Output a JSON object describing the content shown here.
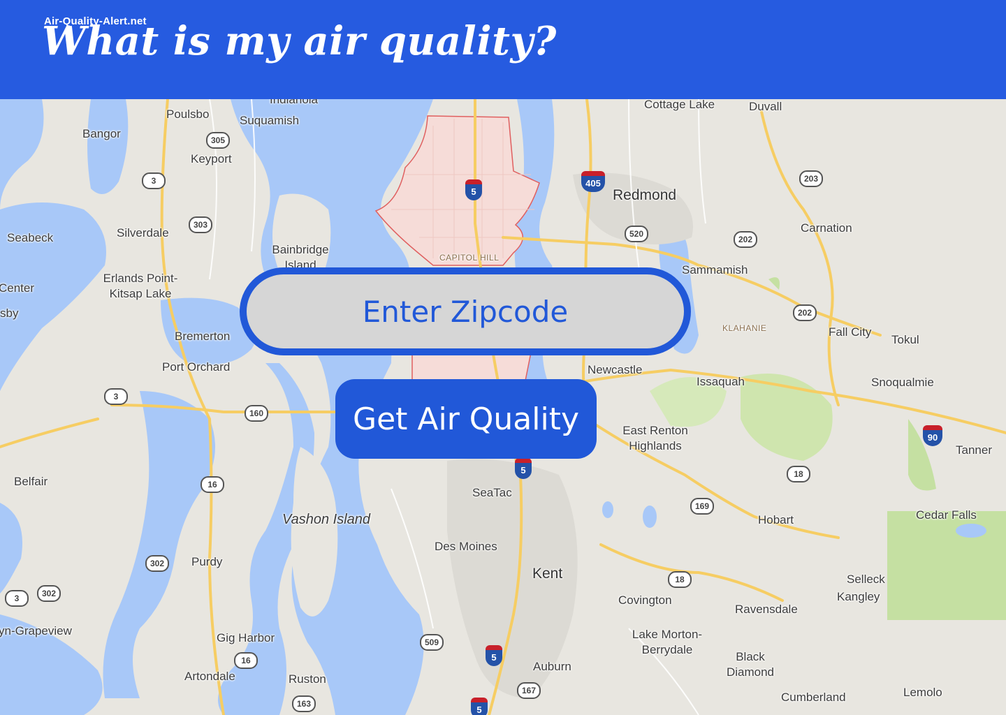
{
  "header": {
    "site_name": "Air-Quality-Alert.net",
    "title": "What is my air quality?"
  },
  "form": {
    "zip_placeholder": "Enter Zipcode",
    "submit_label": "Get Air Quality"
  },
  "map": {
    "places": {
      "indianola": "Indianola",
      "poulsbo": "Poulsbo",
      "suquamish": "Suquamish",
      "bangor": "Bangor",
      "keyport": "Keyport",
      "silverdale": "Silverdale",
      "seabeck": "Seabeck",
      "bainbridge": "Bainbridge Island",
      "erlands": "Erlands Point-Kitsap Lake",
      "center": "Center",
      "sby": "sby",
      "bremerton": "Bremerton",
      "port_orchard": "Port Orchard",
      "capitol_hill": "CAPITOL HILL",
      "cottage_lake": "Cottage Lake",
      "duvall": "Duvall",
      "redmond": "Redmond",
      "carnation": "Carnation",
      "sammamish": "Sammamish",
      "klahanie": "KLAHANIE",
      "fall_city": "Fall City",
      "tokul": "Tokul",
      "newcastle": "Newcastle",
      "issaquah": "Issaquah",
      "snoqualmie": "Snoqualmie",
      "east_renton": "East Renton Highlands",
      "tanner": "Tanner",
      "belfair": "Belfair",
      "seatac": "SeaTac",
      "vashon": "Vashon Island",
      "des_moines": "Des Moines",
      "hobart": "Hobart",
      "cedar_falls": "Cedar Falls",
      "purdy": "Purdy",
      "kent": "Kent",
      "selleck": "Selleck",
      "kangley": "Kangley",
      "covington": "Covington",
      "grapeview": "yn-Grapeview",
      "ravensdale": "Ravensdale",
      "gig_harbor": "Gig Harbor",
      "lake_morton": "Lake Morton-Berrydale",
      "black_diamond": "Black Diamond",
      "artondale": "Artondale",
      "ruston": "Ruston",
      "auburn": "Auburn",
      "cumberland": "Cumberland",
      "lemolo": "Lemolo"
    },
    "routes": {
      "r305": "305",
      "r3a": "3",
      "r303": "303",
      "r3b": "3",
      "r160": "160",
      "r16a": "16",
      "r302a": "302",
      "r302b": "302",
      "r3c": "3",
      "r16b": "16",
      "r163": "163",
      "r509": "509",
      "r167": "167",
      "r520": "520",
      "r203": "203",
      "r202a": "202",
      "r202b": "202",
      "r18a": "18",
      "r169": "169",
      "r18b": "18"
    },
    "interstates": {
      "i405": "405",
      "i5a": "5",
      "i5b": "5",
      "i5c": "5",
      "i5d": "5",
      "i90": "90"
    }
  },
  "colors": {
    "brand": "#265be0",
    "button": "#2158d8",
    "input_bg": "#d6d6d6",
    "water": "#a8c8f8",
    "land": "#e8e6e0",
    "park": "#c5e0a2",
    "highway": "#f6cd63"
  }
}
